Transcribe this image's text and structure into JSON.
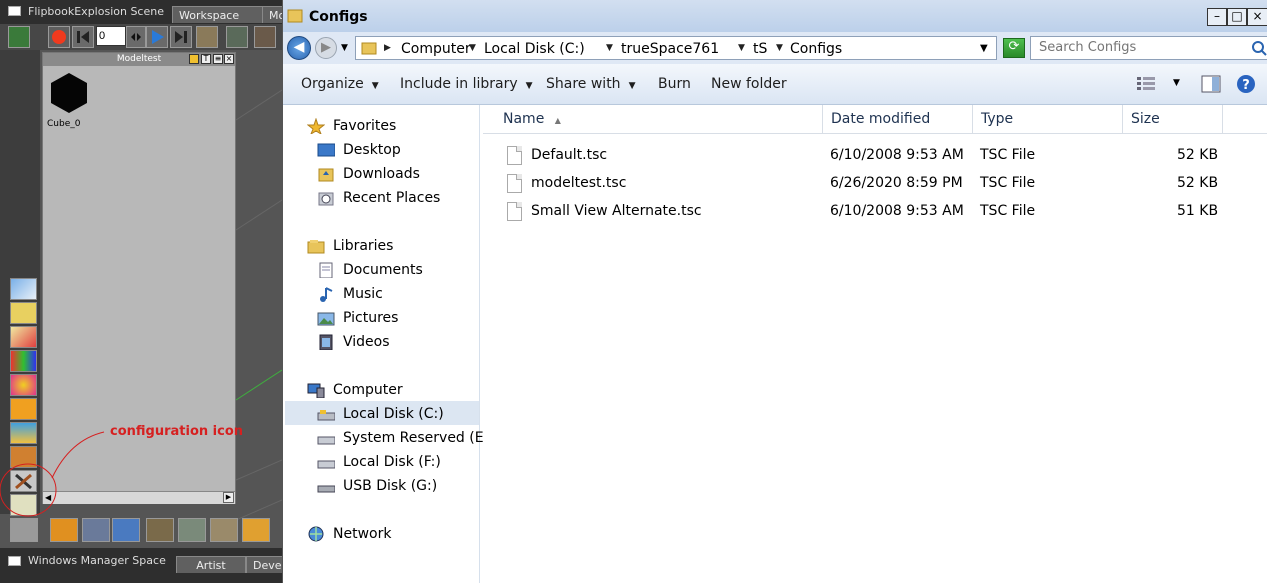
{
  "truespace": {
    "window_title": "FlipbookExplosion Scene",
    "tabs": [
      "Workspace",
      "Mo"
    ],
    "frame_value": "0",
    "library_panel": {
      "title": "Modeltest",
      "item_label": "Cube_0"
    },
    "annotation_text": "configuration icon",
    "bottom_bar": {
      "title": "Windows Manager Space",
      "tabs": [
        "Artist",
        "Deve"
      ]
    }
  },
  "explorer": {
    "window_title": "Configs",
    "address": {
      "crumbs": [
        "Computer",
        "Local Disk (C:)",
        "trueSpace761",
        "tS",
        "Configs"
      ]
    },
    "search": {
      "placeholder": "Search Configs"
    },
    "command_bar": {
      "organize": "Organize",
      "include_in_library": "Include in library",
      "share_with": "Share with",
      "burn": "Burn",
      "new_folder": "New folder"
    },
    "nav": {
      "favorites": "Favorites",
      "desktop": "Desktop",
      "downloads": "Downloads",
      "recent_places": "Recent Places",
      "libraries": "Libraries",
      "documents": "Documents",
      "music": "Music",
      "pictures": "Pictures",
      "videos": "Videos",
      "computer": "Computer",
      "local_disk_c": "Local Disk (C:)",
      "system_reserved": "System Reserved (E:)",
      "local_disk_f": "Local Disk (F:)",
      "usb_disk": "USB Disk (G:)",
      "network": "Network"
    },
    "columns": {
      "name": "Name",
      "date": "Date modified",
      "type": "Type",
      "size": "Size"
    },
    "files": [
      {
        "name": "Default.tsc",
        "date": "6/10/2008 9:53 AM",
        "type": "TSC File",
        "size": "52 KB"
      },
      {
        "name": "modeltest.tsc",
        "date": "6/26/2020 8:59 PM",
        "type": "TSC File",
        "size": "52 KB"
      },
      {
        "name": "Small View Alternate.tsc",
        "date": "6/10/2008 9:53 AM",
        "type": "TSC File",
        "size": "51 KB"
      }
    ]
  }
}
